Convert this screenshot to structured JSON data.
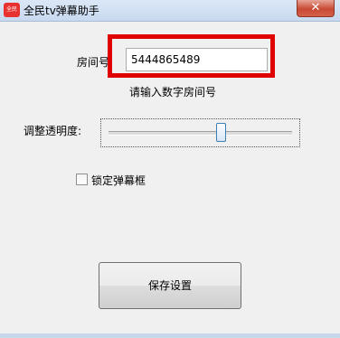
{
  "window": {
    "title": "全民tv弹幕助手",
    "icon_text": "全民TV",
    "close_label": "✕"
  },
  "room": {
    "label": "房间号",
    "value": "5444865489",
    "hint": "请输入数字房间号"
  },
  "opacity": {
    "label": "调整透明度:",
    "level": 0.62
  },
  "lock": {
    "label": "锁定弹幕框",
    "checked": false
  },
  "save_button": {
    "label": "保存设置"
  },
  "colors": {
    "highlight_border": "#e00000",
    "app_icon": "#e8322f",
    "slider_thumb_border": "#3c7fb1"
  }
}
